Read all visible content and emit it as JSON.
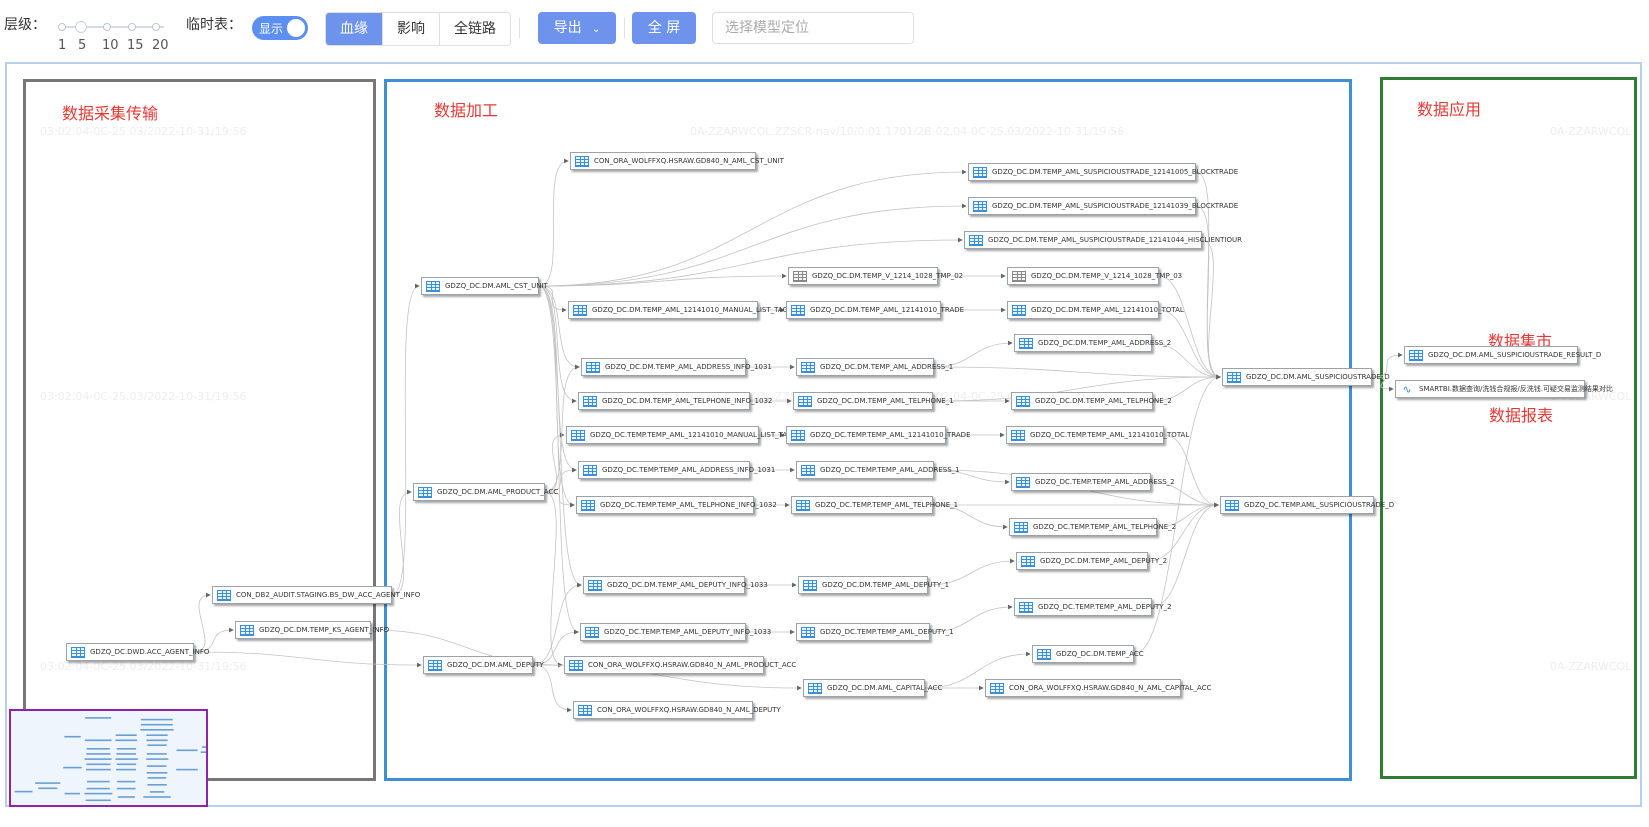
{
  "toolbar": {
    "level_label": "层级：",
    "level_ticks": [
      "1",
      "5",
      "10",
      "15",
      "20"
    ],
    "temp_label": "临时表：",
    "temp_toggle": "显示",
    "tabs": [
      "血缘",
      "影响",
      "全链路"
    ],
    "export_label": "导出",
    "fullscreen_label": "全 屏",
    "search_placeholder": "选择模型定位"
  },
  "zones": {
    "collect": "数据采集传输",
    "process": "数据加工",
    "app": "数据应用",
    "mart": "数据集市",
    "report": "数据报表"
  },
  "colors": {
    "accent": "#6d93ec",
    "zone_collect": "#777777",
    "zone_process": "#3d8fd6",
    "zone_app": "#2e7d32",
    "minimap_border": "#8e24aa",
    "zone_title": "#e53935"
  },
  "nodes": [
    {
      "id": "n1",
      "label": "GDZQ_DC.DWD.ACC_AGENT_INFO",
      "icon": "table-icon"
    },
    {
      "id": "n2",
      "label": "CON_DB2_AUDIT.STAGING.BS_DW_ACC_AGENT_INFO",
      "icon": "table-icon"
    },
    {
      "id": "n3",
      "label": "GDZQ_DC.DM.TEMP_KS_AGENT_INFO",
      "icon": "table-icon"
    },
    {
      "id": "n4",
      "label": "GDZQ_DC.DM.AML_CST_UNIT",
      "icon": "table-icon"
    },
    {
      "id": "n5",
      "label": "GDZQ_DC.DM.AML_PRODUCT_ACC",
      "icon": "table-icon"
    },
    {
      "id": "n6",
      "label": "GDZQ_DC.DM.AML_DEPUTY",
      "icon": "table-icon"
    },
    {
      "id": "n7",
      "label": "CON_ORA_WOLFFXQ.HSRAW.GD840_N_AML_CST_UNIT",
      "icon": "table-icon"
    },
    {
      "id": "n8",
      "label": "GDZQ_DC.DM.TEMP_AML_12141010_MANUAL_LIST_TAG",
      "icon": "table-icon"
    },
    {
      "id": "n9",
      "label": "GDZQ_DC.DM.TEMP_AML_ADDRESS_INFO_1031",
      "icon": "table-icon"
    },
    {
      "id": "n10",
      "label": "GDZQ_DC.DM.TEMP_AML_TELPHONE_INFO_1032",
      "icon": "table-icon"
    },
    {
      "id": "n11",
      "label": "GDZQ_DC.TEMP.TEMP_AML_12141010_MANUAL_LIST_TAG",
      "icon": "table-icon"
    },
    {
      "id": "n12",
      "label": "GDZQ_DC.TEMP.TEMP_AML_ADDRESS_INFO_1031",
      "icon": "table-icon"
    },
    {
      "id": "n13",
      "label": "GDZQ_DC.TEMP.TEMP_AML_TELPHONE_INFO_1032",
      "icon": "table-icon"
    },
    {
      "id": "n14",
      "label": "GDZQ_DC.DM.TEMP_AML_DEPUTY_INFO_1033",
      "icon": "table-icon"
    },
    {
      "id": "n15",
      "label": "GDZQ_DC.TEMP.TEMP_AML_DEPUTY_INFO_1033",
      "icon": "table-icon"
    },
    {
      "id": "n16",
      "label": "CON_ORA_WOLFFXQ.HSRAW.GD840_N_AML_PRODUCT_ACC",
      "icon": "table-icon"
    },
    {
      "id": "n17",
      "label": "CON_ORA_WOLFFXQ.HSRAW.GD840_N_AML_DEPUTY",
      "icon": "table-icon"
    },
    {
      "id": "n18",
      "label": "GDZQ_DC.DM.TEMP_V_1214_1028_TMP_02",
      "icon": "table-gray-icon"
    },
    {
      "id": "n19",
      "label": "GDZQ_DC.DM.TEMP_AML_12141010_TRADE",
      "icon": "table-icon"
    },
    {
      "id": "n20",
      "label": "GDZQ_DC.DM.TEMP_AML_ADDRESS_1",
      "icon": "table-icon"
    },
    {
      "id": "n21",
      "label": "GDZQ_DC.DM.TEMP_AML_TELPHONE_1",
      "icon": "table-icon"
    },
    {
      "id": "n22",
      "label": "GDZQ_DC.TEMP.TEMP_AML_12141010_TRADE",
      "icon": "table-icon"
    },
    {
      "id": "n23",
      "label": "GDZQ_DC.TEMP.TEMP_AML_ADDRESS_1",
      "icon": "table-icon"
    },
    {
      "id": "n24",
      "label": "GDZQ_DC.TEMP.TEMP_AML_TELPHONE_1",
      "icon": "table-icon"
    },
    {
      "id": "n25",
      "label": "GDZQ_DC.DM.TEMP_AML_DEPUTY_1",
      "icon": "table-icon"
    },
    {
      "id": "n26",
      "label": "GDZQ_DC.TEMP.TEMP_AML_DEPUTY_1",
      "icon": "table-icon"
    },
    {
      "id": "n27",
      "label": "GDZQ_DC.DM.AML_CAPITAL_ACC",
      "icon": "table-icon"
    },
    {
      "id": "n28",
      "label": "GDZQ_DC.DM.TEMP_AML_SUSPICIOUSTRADE_12141005_BLOCKTRADE",
      "icon": "table-icon"
    },
    {
      "id": "n29",
      "label": "GDZQ_DC.DM.TEMP_AML_SUSPICIOUSTRADE_12141039_BLOCKTRADE",
      "icon": "table-icon"
    },
    {
      "id": "n30",
      "label": "GDZQ_DC.DM.TEMP_AML_SUSPICIOUSTRADE_12141044_HISCLIENTIOUR",
      "icon": "table-icon"
    },
    {
      "id": "n31",
      "label": "GDZQ_DC.DM.TEMP_V_1214_1028_TMP_03",
      "icon": "table-gray-icon"
    },
    {
      "id": "n32",
      "label": "GDZQ_DC.DM.TEMP_AML_12141010_TOTAL",
      "icon": "table-icon"
    },
    {
      "id": "n33",
      "label": "GDZQ_DC.DM.TEMP_AML_ADDRESS_2",
      "icon": "table-icon"
    },
    {
      "id": "n34",
      "label": "GDZQ_DC.DM.TEMP_AML_TELPHONE_2",
      "icon": "table-icon"
    },
    {
      "id": "n35",
      "label": "GDZQ_DC.TEMP.TEMP_AML_12141010_TOTAL",
      "icon": "table-icon"
    },
    {
      "id": "n36",
      "label": "GDZQ_DC.TEMP.TEMP_AML_ADDRESS_2",
      "icon": "table-icon"
    },
    {
      "id": "n37",
      "label": "GDZQ_DC.TEMP.TEMP_AML_TELPHONE_2",
      "icon": "table-icon"
    },
    {
      "id": "n38",
      "label": "GDZQ_DC.DM.TEMP_AML_DEPUTY_2",
      "icon": "table-icon"
    },
    {
      "id": "n39",
      "label": "GDZQ_DC.TEMP.TEMP_AML_DEPUTY_2",
      "icon": "table-icon"
    },
    {
      "id": "n40",
      "label": "GDZQ_DC.DM.TEMP_ACC",
      "icon": "table-icon"
    },
    {
      "id": "n41",
      "label": "CON_ORA_WOLFFXQ.HSRAW.GD840_N_AML_CAPITAL_ACC",
      "icon": "table-icon"
    },
    {
      "id": "n42",
      "label": "GDZQ_DC.DM.AML_SUSPICIOUSTRADE_D",
      "icon": "table-icon"
    },
    {
      "id": "n43",
      "label": "GDZQ_DC.TEMP.AML_SUSPICIOUSTRADE_D",
      "icon": "table-icon"
    },
    {
      "id": "n44",
      "label": "GDZQ_DC.DM.AML_SUSPICIOUSTRADE_RESULT_D",
      "icon": "table-icon"
    },
    {
      "id": "n45",
      "label": "SMARTBI.数据查询/洗钱合规报/反洗钱.可疑交易监测结果对比",
      "icon": "chart-icon"
    }
  ],
  "edges": [
    [
      "n1",
      "n2"
    ],
    [
      "n1",
      "n3"
    ],
    [
      "n1",
      "n6"
    ],
    [
      "n2",
      "n4"
    ],
    [
      "n2",
      "n5"
    ],
    [
      "n3",
      "n16"
    ],
    [
      "n4",
      "n7"
    ],
    [
      "n4",
      "n28"
    ],
    [
      "n4",
      "n29"
    ],
    [
      "n4",
      "n30"
    ],
    [
      "n4",
      "n18"
    ],
    [
      "n4",
      "n8"
    ],
    [
      "n4",
      "n9"
    ],
    [
      "n4",
      "n10"
    ],
    [
      "n4",
      "n12"
    ],
    [
      "n4",
      "n13"
    ],
    [
      "n4",
      "n14"
    ],
    [
      "n4",
      "n15"
    ],
    [
      "n5",
      "n11"
    ],
    [
      "n5",
      "n12"
    ],
    [
      "n5",
      "n16"
    ],
    [
      "n5",
      "n9"
    ],
    [
      "n5",
      "n13"
    ],
    [
      "n6",
      "n14"
    ],
    [
      "n6",
      "n15"
    ],
    [
      "n6",
      "n17"
    ],
    [
      "n6",
      "n27"
    ],
    [
      "n8",
      "n19"
    ],
    [
      "n9",
      "n20"
    ],
    [
      "n10",
      "n21"
    ],
    [
      "n11",
      "n22"
    ],
    [
      "n12",
      "n23"
    ],
    [
      "n13",
      "n24"
    ],
    [
      "n14",
      "n25"
    ],
    [
      "n15",
      "n26"
    ],
    [
      "n18",
      "n31"
    ],
    [
      "n19",
      "n32"
    ],
    [
      "n20",
      "n33"
    ],
    [
      "n20",
      "n42"
    ],
    [
      "n21",
      "n34"
    ],
    [
      "n21",
      "n42"
    ],
    [
      "n22",
      "n35"
    ],
    [
      "n23",
      "n36"
    ],
    [
      "n23",
      "n43"
    ],
    [
      "n24",
      "n37"
    ],
    [
      "n24",
      "n43"
    ],
    [
      "n25",
      "n38"
    ],
    [
      "n26",
      "n39"
    ],
    [
      "n27",
      "n40"
    ],
    [
      "n27",
      "n41"
    ],
    [
      "n28",
      "n42"
    ],
    [
      "n29",
      "n42"
    ],
    [
      "n30",
      "n42"
    ],
    [
      "n31",
      "n42"
    ],
    [
      "n32",
      "n42"
    ],
    [
      "n33",
      "n42"
    ],
    [
      "n34",
      "n42"
    ],
    [
      "n35",
      "n43"
    ],
    [
      "n36",
      "n43"
    ],
    [
      "n37",
      "n43"
    ],
    [
      "n38",
      "n43"
    ],
    [
      "n39",
      "n43"
    ],
    [
      "n40",
      "n42"
    ],
    [
      "n42",
      "n44"
    ],
    [
      "n42",
      "n45"
    ]
  ],
  "watermarks": [
    "0A-ZZARWCOL.ZZSCR-nav/10/0.01.1701/2B-02.04-0C-25.03/2022-10-31/19:56",
    "03:02:04-0C-25.03/2022-10-31/19:56",
    "0A-ZZARWCOL"
  ]
}
